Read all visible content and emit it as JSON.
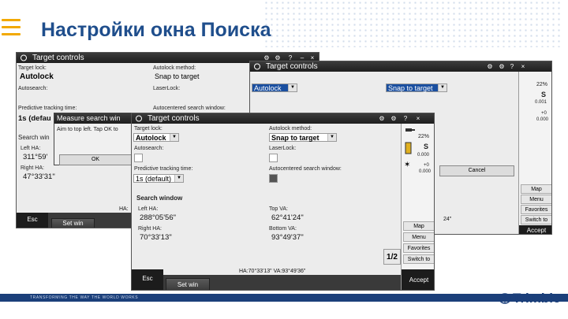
{
  "slide": {
    "title": "Настройки окна Поиска",
    "footer_text": "TRANSFORMING THE WAY THE WORLD WORKS",
    "logo_text": "Trimble",
    "accent_color": "#f2a900",
    "title_color": "#1f4e8c"
  },
  "window_back": {
    "title": "Target controls",
    "target_lock_label": "Target lock:",
    "target_lock_value": "Autolock",
    "autolock_method_label": "Autolock method:",
    "autolock_method_value": "Snap to target",
    "autosearch_label": "Autosearch:",
    "laserlock_label": "LaserLock:",
    "predictive_label": "Predictive tracking time:",
    "predictive_value": "1s (defau",
    "autocentered_label": "Autocentered search window:",
    "search_label": "Search win",
    "left_ha_label": "Left HA:",
    "left_ha_value": "311°59'",
    "right_ha_label": "Right HA:",
    "right_ha_value": "47°33'31\"",
    "ha_text": "HA:",
    "esc_label": "Esc",
    "set_win_label": "Set win",
    "dialog_title": "Measure search win",
    "dialog_text": "Aim to top left. Tap OK to",
    "ok_label": "OK"
  },
  "window_right": {
    "target_lock_value": "Autolock",
    "autolock_method_value": "Snap to target",
    "cancel_label": "Cancel",
    "battery": "22%",
    "target_s": "S",
    "prism_val": "0.001",
    "plus_val": "+0",
    "zero_val": "0.000",
    "map_label": "Map",
    "menu_label": "Menu",
    "favorites_label": "Favorites",
    "switch_label": "Switch to",
    "accept_label": "Accept",
    "vertical_angle": "24\""
  },
  "window_front": {
    "title": "Target controls",
    "target_lock_label": "Target lock:",
    "target_lock_value": "Autolock",
    "autolock_method_label": "Autolock method:",
    "autolock_method_value": "Snap to target",
    "autosearch_label": "Autosearch:",
    "laserlock_label": "LaserLock:",
    "predictive_label": "Predictive tracking time:",
    "predictive_value": "1s (default)",
    "autocentered_label": "Autocentered search window:",
    "search_window_heading": "Search window",
    "left_ha_label": "Left HA:",
    "left_ha_value": "288°05'56\"",
    "top_va_label": "Top VA:",
    "top_va_value": "62°41'24\"",
    "right_ha_label": "Right HA:",
    "right_ha_value": "70°33'13\"",
    "bottom_va_label": "Bottom VA:",
    "bottom_va_value": "93°49'37\"",
    "status_text": "HA:70°33'13\" VA:93°49'36\"",
    "esc_label": "Esc",
    "set_win_label": "Set win",
    "accept_label": "Accept",
    "map_label": "Map",
    "menu_label": "Menu",
    "favorites_label": "Favorites",
    "switch_label": "Switch to",
    "pager": "1/2",
    "battery": "22%",
    "target_s": "S",
    "prism_val": "0.000",
    "plus_val": "+0",
    "zero_val": "0.000",
    "ctrl_help": "?",
    "ctrl_close": "×"
  }
}
